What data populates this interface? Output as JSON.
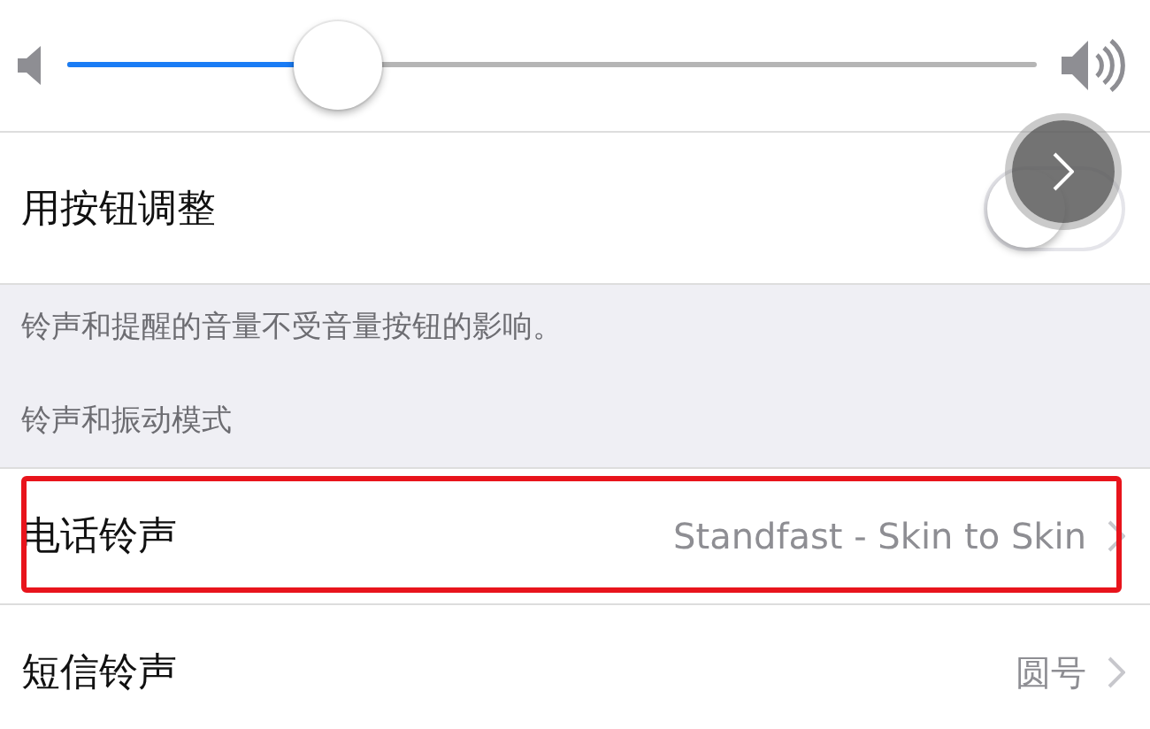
{
  "volume_slider": {
    "level": 0.28
  },
  "button_adjust": {
    "label": "用按钮调整",
    "on": false
  },
  "note": "铃声和提醒的音量不受音量按钮的影响。",
  "section_header": "铃声和振动模式",
  "rows": [
    {
      "label": "电话铃声",
      "value": "Standfast - Skin to Skin",
      "highlighted": true
    },
    {
      "label": "短信铃声",
      "value": "圆号",
      "highlighted": false
    }
  ]
}
